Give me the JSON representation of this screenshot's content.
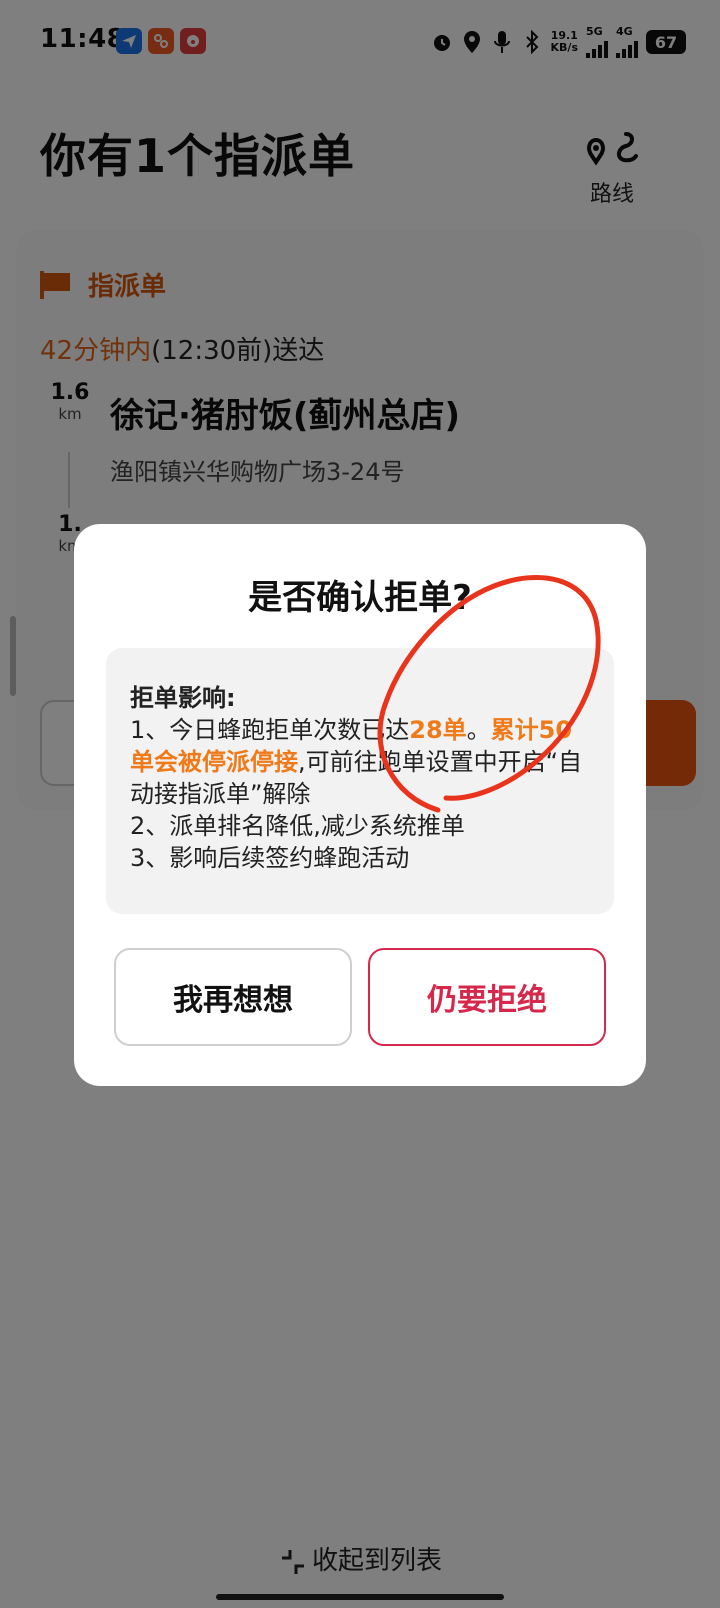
{
  "status_bar": {
    "time": "11:48",
    "net_speed": "19.1",
    "net_unit": "KB/s",
    "net1": "5G",
    "net2": "4G",
    "battery": "67"
  },
  "header": {
    "title": "你有1个指派单",
    "route_label": "路线"
  },
  "order": {
    "tag": "指派单",
    "deadline_accent": "42分钟内",
    "deadline_rest": "(12:30前)送达",
    "stops": [
      {
        "distance": "1.6",
        "unit": "km",
        "name": "徐记·猪肘饭(蓟州总店)",
        "address": "渔阳镇兴华购物广场3-24号"
      },
      {
        "distance": "1.",
        "unit": "km"
      }
    ]
  },
  "dialog": {
    "title": "是否确认拒单?",
    "impact_heading": "拒单影响:",
    "line1_pre": "1、今日蜂跑拒单次数已达",
    "line1_count": "28单",
    "line1_mid": "。",
    "line1_warn": "累计50单会被停派停接",
    "line1_post": ",可前往跑单设置中开启“自动接指派单”解除",
    "line2": "2、派单排名降低,减少系统推单",
    "line3": "3、影响后续签约蜂跑活动",
    "cancel_label": "我再想想",
    "confirm_label": "仍要拒绝"
  },
  "footer": {
    "collapse_label": "收起到列表"
  },
  "colors": {
    "accent_orange": "#e0651b",
    "reject_red": "#d5294b",
    "annotation_red": "#e8341c"
  }
}
